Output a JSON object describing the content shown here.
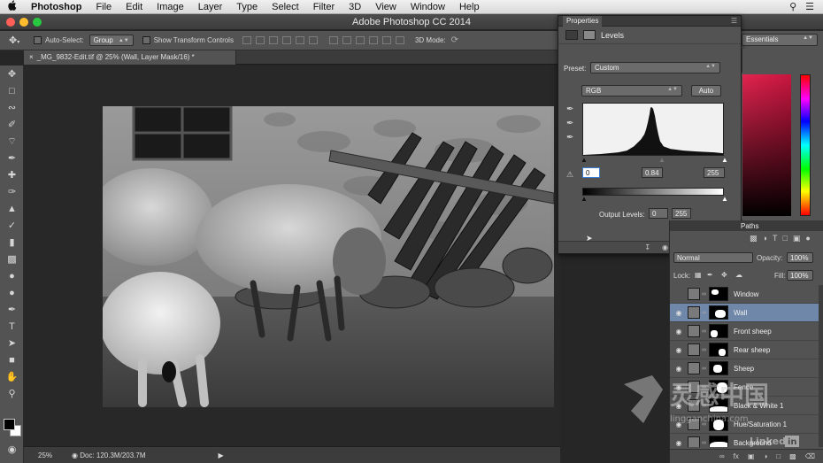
{
  "menubar": {
    "apple": "",
    "items": [
      "Photoshop",
      "File",
      "Edit",
      "Image",
      "Layer",
      "Type",
      "Select",
      "Filter",
      "3D",
      "View",
      "Window",
      "Help"
    ]
  },
  "window": {
    "title": "Adobe Photoshop CC 2014"
  },
  "options": {
    "auto_select_label": "Auto-Select:",
    "auto_select_value": "Group",
    "transform_label": "Show Transform Controls",
    "mode3d_label": "3D Mode:",
    "workspace": "Essentials"
  },
  "document": {
    "tab_label": "_MG_9832-Edit.tif @ 25% (Wall, Layer Mask/16) *",
    "zoom": "25%",
    "doc_size": "Doc: 120.3M/203.7M"
  },
  "properties": {
    "tab": "Properties",
    "adjustment": "Levels",
    "preset_label": "Preset:",
    "preset_value": "Custom",
    "channel": "RGB",
    "auto_button": "Auto",
    "input_black": "0",
    "input_gamma": "0.84",
    "input_white": "255",
    "output_label": "Output Levels:",
    "output_black": "0",
    "output_white": "255"
  },
  "layers": {
    "tab_paths": "Paths",
    "blend_mode": "Normal",
    "opacity_label": "Opacity:",
    "opacity_value": "100%",
    "lock_label": "Lock:",
    "fill_label": "Fill:",
    "fill_value": "100%",
    "items": [
      {
        "name": "Window",
        "visible": false,
        "selected": false
      },
      {
        "name": "Wall",
        "visible": true,
        "selected": true
      },
      {
        "name": "Front sheep",
        "visible": true,
        "selected": false
      },
      {
        "name": "Rear sheep",
        "visible": true,
        "selected": false
      },
      {
        "name": "Sheep",
        "visible": true,
        "selected": false
      },
      {
        "name": "Fence",
        "visible": true,
        "selected": false
      },
      {
        "name": "Black & White 1",
        "visible": true,
        "selected": false
      },
      {
        "name": "Hue/Saturation 1",
        "visible": true,
        "selected": false
      },
      {
        "name": "Background",
        "visible": true,
        "selected": false
      }
    ]
  },
  "watermark": {
    "brand_cn": "灵感中国",
    "url": "lingganchina.com",
    "linkedin": "Linked in"
  }
}
